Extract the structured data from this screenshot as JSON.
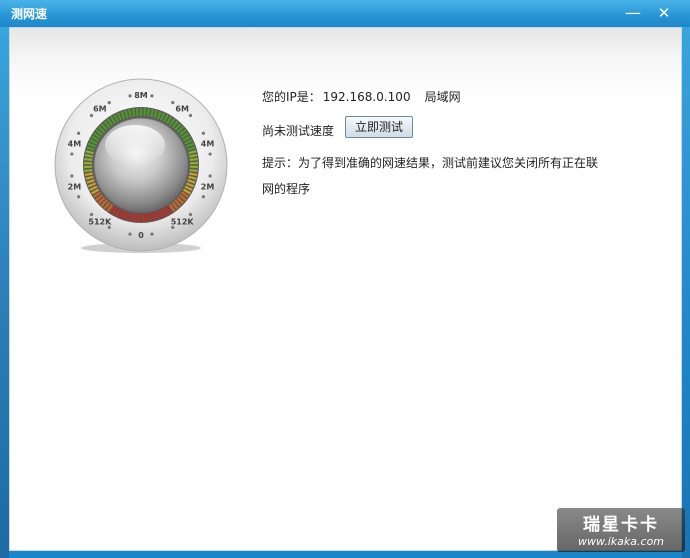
{
  "window": {
    "title": "测网速",
    "minimize_glyph": "—",
    "close_glyph": "✕"
  },
  "info": {
    "ip_label": "您的IP是：",
    "ip_value": "192.168.0.100",
    "network_type": "局域网",
    "status_text": "尚未测试速度",
    "test_button": "立即测试",
    "tip": "提示：为了得到准确的网速结果，测试前建议您关闭所有正在联网的程序"
  },
  "gauge": {
    "labels": [
      "0",
      "512K",
      "2M",
      "4M",
      "6M",
      "8M",
      "6M",
      "4M",
      "2M",
      "512K"
    ]
  },
  "watermark": {
    "title": "瑞星卡卡",
    "url": "www.ikaka.com"
  }
}
